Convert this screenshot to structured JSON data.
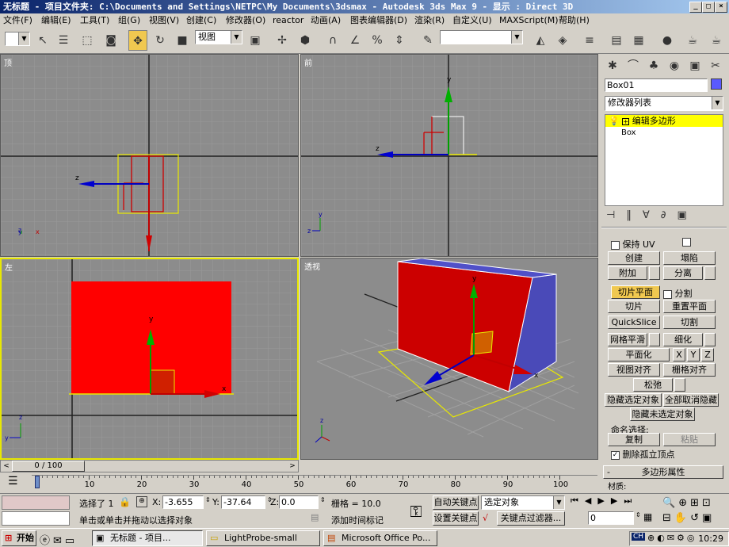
{
  "title_bar": {
    "text": "无标题   - 项目文件夹: C:\\Documents and Settings\\NETPC\\My Documents\\3dsmax   - Autodesk 3ds Max 9   - 显示 : Direct 3D",
    "buttons": [
      "_",
      "□",
      "×"
    ]
  },
  "menu": [
    "文件(F)",
    "编辑(E)",
    "工具(T)",
    "组(G)",
    "视图(V)",
    "创建(C)",
    "修改器(O)",
    "reactor",
    "动画(A)",
    "图表编辑器(D)",
    "渲染(R)",
    "自定义(U)",
    "MAXScript(M)",
    "帮助(H)"
  ],
  "toolbar": {
    "view_combo": "视图",
    "selection_set_combo": ""
  },
  "viewports": {
    "top": "顶",
    "front": "前",
    "left": "左",
    "perspective": "透视"
  },
  "axes": {
    "x": "x",
    "y": "y",
    "z": "z"
  },
  "command_panel": {
    "object_name": "Box01",
    "object_color": "#5a5aff",
    "modifier_list": "修改器列表",
    "stack_items": [
      "编辑多边形",
      "Box"
    ],
    "preserve_uv": "保持 UV",
    "buttons": {
      "create": "创建",
      "collapse": "塌陷",
      "attach": "附加",
      "detach": "分离",
      "slice_plane": "切片平面",
      "split": "分割",
      "slice": "切片",
      "reset_plane": "重置平面",
      "quickslice": "QuickSlice",
      "cut": "切割",
      "meshsmooth": "网格平滑",
      "tessellate": "细化",
      "make_planar": "平面化",
      "x": "X",
      "y": "Y",
      "z": "Z",
      "view_align": "视图对齐",
      "grid_align": "栅格对齐",
      "relax": "松弛",
      "hide_selected": "隐藏选定对象",
      "unhide_all": "全部取消隐藏",
      "hide_unselected": "隐藏未选定对象"
    },
    "named_selections": "命名选择:",
    "copy": "复制",
    "paste": "粘贴",
    "delete_isolated": "删除孤立顶点",
    "rollout_title": "多边形属性",
    "material_label": "材质:"
  },
  "timeline": {
    "frame": "0 / 100",
    "ticks": [
      "0",
      "10",
      "20",
      "30",
      "40",
      "50",
      "60",
      "70",
      "80",
      "90",
      "100"
    ]
  },
  "status": {
    "selected": "选择了 1",
    "x_label": "X:",
    "x_value": "-3.655",
    "y_label": "Y:",
    "y_value": "-37.64",
    "z_label": "Z:",
    "z_value": "0.0",
    "grid": "栅格 = 10.0",
    "prompt": "单击或单击并拖动以选择对象",
    "add_time_tag": "添加时间标记",
    "auto_key": "自动关键点",
    "set_key": "设置关键点",
    "key_target": "选定对象",
    "key_filters": "关键点过滤器...",
    "current_frame": "0"
  },
  "taskbar": {
    "start": "开始",
    "tasks": [
      "无标题    - 项目...",
      "LightProbe-small",
      "Microsoft Office Po..."
    ],
    "ime": "CH",
    "clock": "10:29"
  }
}
